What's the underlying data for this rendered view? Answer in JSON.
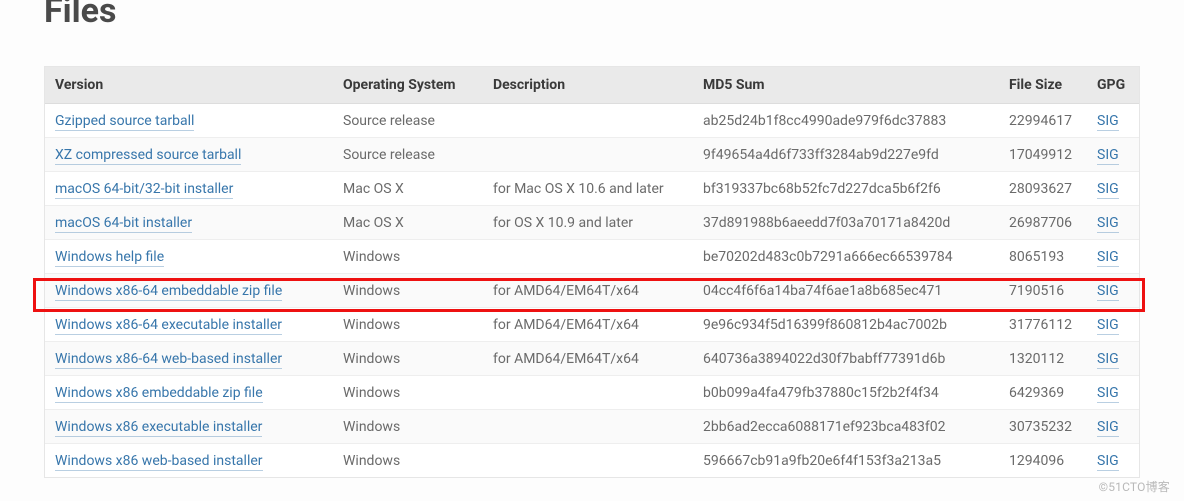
{
  "heading": "Files",
  "columns": {
    "version": "Version",
    "os": "Operating System",
    "desc": "Description",
    "md5": "MD5 Sum",
    "size": "File Size",
    "gpg": "GPG"
  },
  "gpg_label": "SIG",
  "rows": [
    {
      "version": "Gzipped source tarball",
      "os": "Source release",
      "desc": "",
      "md5": "ab25d24b1f8cc4990ade979f6dc37883",
      "size": "22994617"
    },
    {
      "version": "XZ compressed source tarball",
      "os": "Source release",
      "desc": "",
      "md5": "9f49654a4d6f733ff3284ab9d227e9fd",
      "size": "17049912"
    },
    {
      "version": "macOS 64-bit/32-bit installer",
      "os": "Mac OS X",
      "desc": "for Mac OS X 10.6 and later",
      "md5": "bf319337bc68b52fc7d227dca5b6f2f6",
      "size": "28093627"
    },
    {
      "version": "macOS 64-bit installer",
      "os": "Mac OS X",
      "desc": "for OS X 10.9 and later",
      "md5": "37d891988b6aeedd7f03a70171a8420d",
      "size": "26987706"
    },
    {
      "version": "Windows help file",
      "os": "Windows",
      "desc": "",
      "md5": "be70202d483c0b7291a666ec66539784",
      "size": "8065193"
    },
    {
      "version": "Windows x86-64 embeddable zip file",
      "os": "Windows",
      "desc": "for AMD64/EM64T/x64",
      "md5": "04cc4f6f6a14ba74f6ae1a8b685ec471",
      "size": "7190516"
    },
    {
      "version": "Windows x86-64 executable installer",
      "os": "Windows",
      "desc": "for AMD64/EM64T/x64",
      "md5": "9e96c934f5d16399f860812b4ac7002b",
      "size": "31776112"
    },
    {
      "version": "Windows x86-64 web-based installer",
      "os": "Windows",
      "desc": "for AMD64/EM64T/x64",
      "md5": "640736a3894022d30f7babff77391d6b",
      "size": "1320112"
    },
    {
      "version": "Windows x86 embeddable zip file",
      "os": "Windows",
      "desc": "",
      "md5": "b0b099a4fa479fb37880c15f2b2f4f34",
      "size": "6429369"
    },
    {
      "version": "Windows x86 executable installer",
      "os": "Windows",
      "desc": "",
      "md5": "2bb6ad2ecca6088171ef923bca483f02",
      "size": "30735232"
    },
    {
      "version": "Windows x86 web-based installer",
      "os": "Windows",
      "desc": "",
      "md5": "596667cb91a9fb20e6f4f153f3a213a5",
      "size": "1294096"
    }
  ],
  "highlight_row_index": 6,
  "watermark": "©51CTO博客"
}
